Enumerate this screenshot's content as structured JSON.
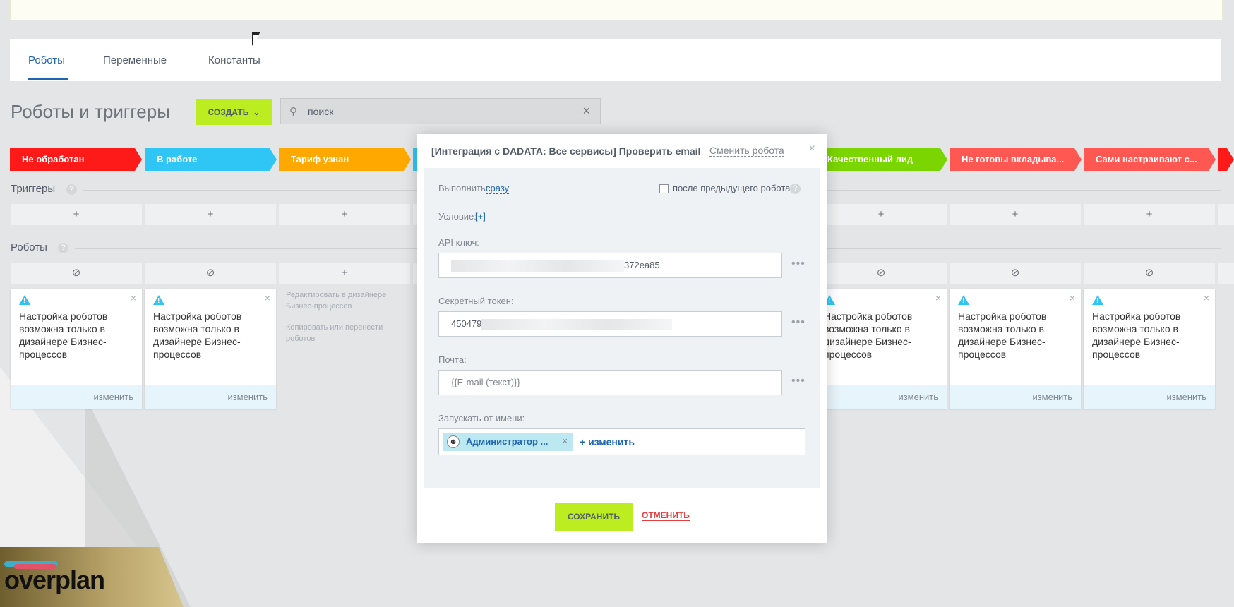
{
  "tabs": [
    {
      "label": "Роботы",
      "active": true
    },
    {
      "label": "Переменные",
      "active": false
    },
    {
      "label": "Константы",
      "active": false
    }
  ],
  "page_title": "Роботы и триггеры",
  "create_label": "СОЗДАТЬ",
  "search": {
    "value": "поиск"
  },
  "stages": [
    {
      "label": "Не обработан",
      "color": "#ff1a1a"
    },
    {
      "label": "В работе",
      "color": "#2fc6f6"
    },
    {
      "label": "Тариф узнан",
      "color": "#ffa900"
    },
    {
      "label": "",
      "color": "#2fc6f6"
    },
    {
      "label": "Качественный лид",
      "color": "#7bd500"
    },
    {
      "label": "Не готовы вкладыва...",
      "color": "#ff5752"
    },
    {
      "label": "Сами настраивают с...",
      "color": "#ff5752"
    }
  ],
  "triggers_label": "Триггеры",
  "robots_label": "Роботы",
  "card": {
    "text": "Настройка роботов возможна только в дизайнере Бизнес-процессов",
    "edit": "изменить"
  },
  "hint": {
    "line1": "Редактировать в дизайнере Бизнес-процессов",
    "line2": "Копировать или перенести роботов"
  },
  "logo": "overplan",
  "modal": {
    "title": "[Интеграция с DADATA: Все сервисы] Проверить email",
    "change_robot": "Сменить робота",
    "execute_label": "Выполнить:",
    "execute_value": "сразу",
    "after_prev": "после предыдущего робота",
    "condition_label": "Условие:",
    "condition_value": "[+]",
    "api_key_label": "API ключ:",
    "api_key_visible": "372ea85",
    "secret_label": "Секретный токен:",
    "secret_visible": "450479",
    "mail_label": "Почта:",
    "mail_value": "{{E-mail (текст)}}",
    "run_as_label": "Запускать от имени:",
    "user_name": "Администратор ...",
    "user_change": "+ изменить",
    "save": "СОХРАНИТЬ",
    "cancel": "ОТМЕНИТЬ"
  }
}
